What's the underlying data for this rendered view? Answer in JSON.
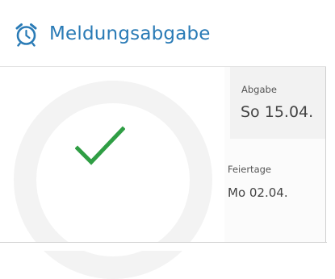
{
  "header": {
    "icon": "alarm-clock-icon",
    "title": "Meldungsabgabe",
    "accent_color": "#2a7bb6"
  },
  "status": {
    "icon": "checkmark-icon",
    "check_color": "#2f9e44",
    "ring_color": "#f3f3f3"
  },
  "submission": {
    "label": "Abgabe",
    "value": "So 15.04."
  },
  "holidays": {
    "label": "Feiertage",
    "value": "Mo 02.04."
  }
}
